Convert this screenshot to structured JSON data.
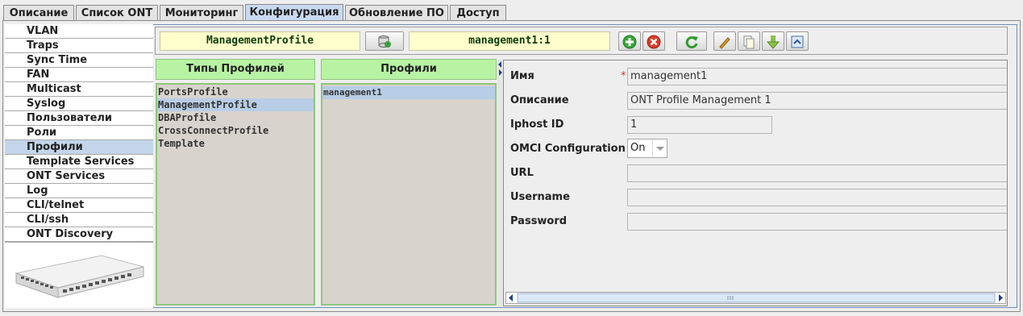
{
  "tabs": [
    {
      "label": "Описание"
    },
    {
      "label": "Список ONT"
    },
    {
      "label": "Мониторинг"
    },
    {
      "label": "Конфигурация",
      "active": true
    },
    {
      "label": "Обновление ПО"
    },
    {
      "label": "Доступ"
    }
  ],
  "sidebar": {
    "items": [
      {
        "label": "VLAN"
      },
      {
        "label": "Traps"
      },
      {
        "label": "Sync Time"
      },
      {
        "label": "FAN"
      },
      {
        "label": "Multicast"
      },
      {
        "label": "Syslog"
      },
      {
        "label": "Пользователи"
      },
      {
        "label": "Роли"
      },
      {
        "label": "Профили",
        "active": true
      },
      {
        "label": "Template Services"
      },
      {
        "label": "ONT Services"
      },
      {
        "label": "Log"
      },
      {
        "label": "CLI/telnet"
      },
      {
        "label": "CLI/ssh"
      },
      {
        "label": "ONT Discovery"
      }
    ],
    "device_image": "olt-device-image"
  },
  "toolbar": {
    "profile_type_value": "ManagementProfile",
    "profile_value": "management1:1",
    "buttons": [
      {
        "icon": "database-refresh-icon"
      },
      {
        "icon": "add-icon"
      },
      {
        "icon": "delete-icon"
      },
      {
        "icon": "refresh-icon"
      },
      {
        "icon": "edit-icon"
      },
      {
        "icon": "copy-icon"
      },
      {
        "icon": "download-icon"
      },
      {
        "icon": "link-icon"
      }
    ]
  },
  "profile_types": {
    "header": "Типы Профилей",
    "items": [
      "PortsProfile",
      "ManagementProfile",
      "DBAProfile",
      "CrossConnectProfile",
      "Template"
    ],
    "selected_index": 1
  },
  "profiles": {
    "header": "Профили",
    "items": [
      "management1"
    ],
    "selected_index": 0
  },
  "form": {
    "name_label": "Имя",
    "name_required": "*",
    "name_value": "management1",
    "description_label": "Описание",
    "description_value": "ONT Profile Management 1",
    "iphost_label": "Iphost ID",
    "iphost_value": "1",
    "omci_label": "OMCI Configuration",
    "omci_value": "On",
    "url_label": "URL",
    "url_value": "",
    "username_label": "Username",
    "username_value": "",
    "password_label": "Password",
    "password_value": ""
  },
  "colors": {
    "panel_header": "#b8f3a4",
    "selection": "#b8cde6",
    "field_yellow": "#ffffcc",
    "active_tab": "#c9daf0"
  }
}
